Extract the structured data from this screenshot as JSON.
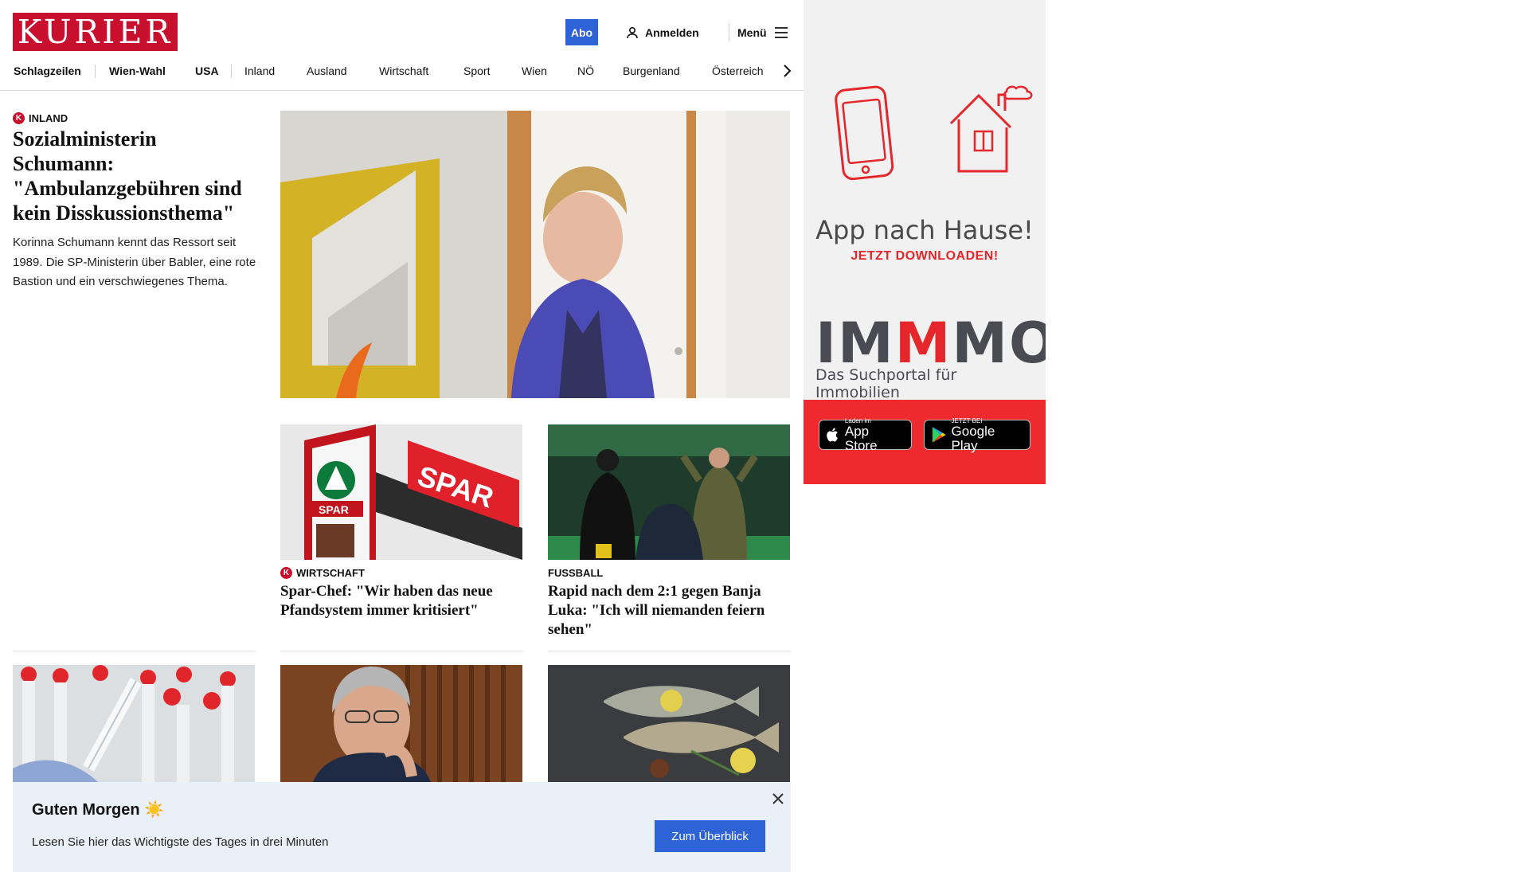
{
  "header": {
    "logo_text": "KURIER",
    "abo_label": "Abo",
    "login_label": "Anmelden",
    "menu_label": "Menü",
    "brand_color": "#c8102e",
    "accent_color": "#2e63d8"
  },
  "nav": {
    "items": [
      "Schlagzeilen",
      "Wien-Wahl",
      "USA",
      "Inland",
      "Ausland",
      "Wirtschaft",
      "Sport",
      "Wien",
      "NÖ",
      "Burgenland",
      "Österreich"
    ],
    "next_icon": "chevron-right-icon"
  },
  "lead": {
    "category": "INLAND",
    "title": "Sozialministerin Schumann: \"Ambulanzgebühren sind kein Disskussionsthema\"",
    "teaser": "Korinna Schumann kennt das Ressort seit 1989. Die SP-Ministerin über Babler, eine rote Bastion und ein verschwiegenes Thema."
  },
  "cards": [
    {
      "category": "WIRTSCHAFT",
      "title": "Spar-Chef: \"Wir haben das neue Pfandsystem immer kritisiert\""
    },
    {
      "category": "FUSSBALL",
      "title": "Rapid nach dem 2:1 gegen Banja Luka: \"Ich will niemanden feiern sehen\""
    }
  ],
  "banner": {
    "title": "Guten Morgen ☀️",
    "text": "Lesen Sie hier das Wichtigste des Tages in drei Minuten",
    "cta": "Zum Überblick"
  },
  "ad": {
    "headline": "App nach Hause!",
    "subline": "JETZT DOWNLOADEN!",
    "brand_pre": "IM",
    "brand_m": "M",
    "brand_post": "MO",
    "tagline": "Das Suchportal für Immobilien",
    "appstore_small": "Laden im",
    "appstore_big": "App Store",
    "googleplay_small": "JETZT BEI",
    "googleplay_big": "Google Play"
  }
}
